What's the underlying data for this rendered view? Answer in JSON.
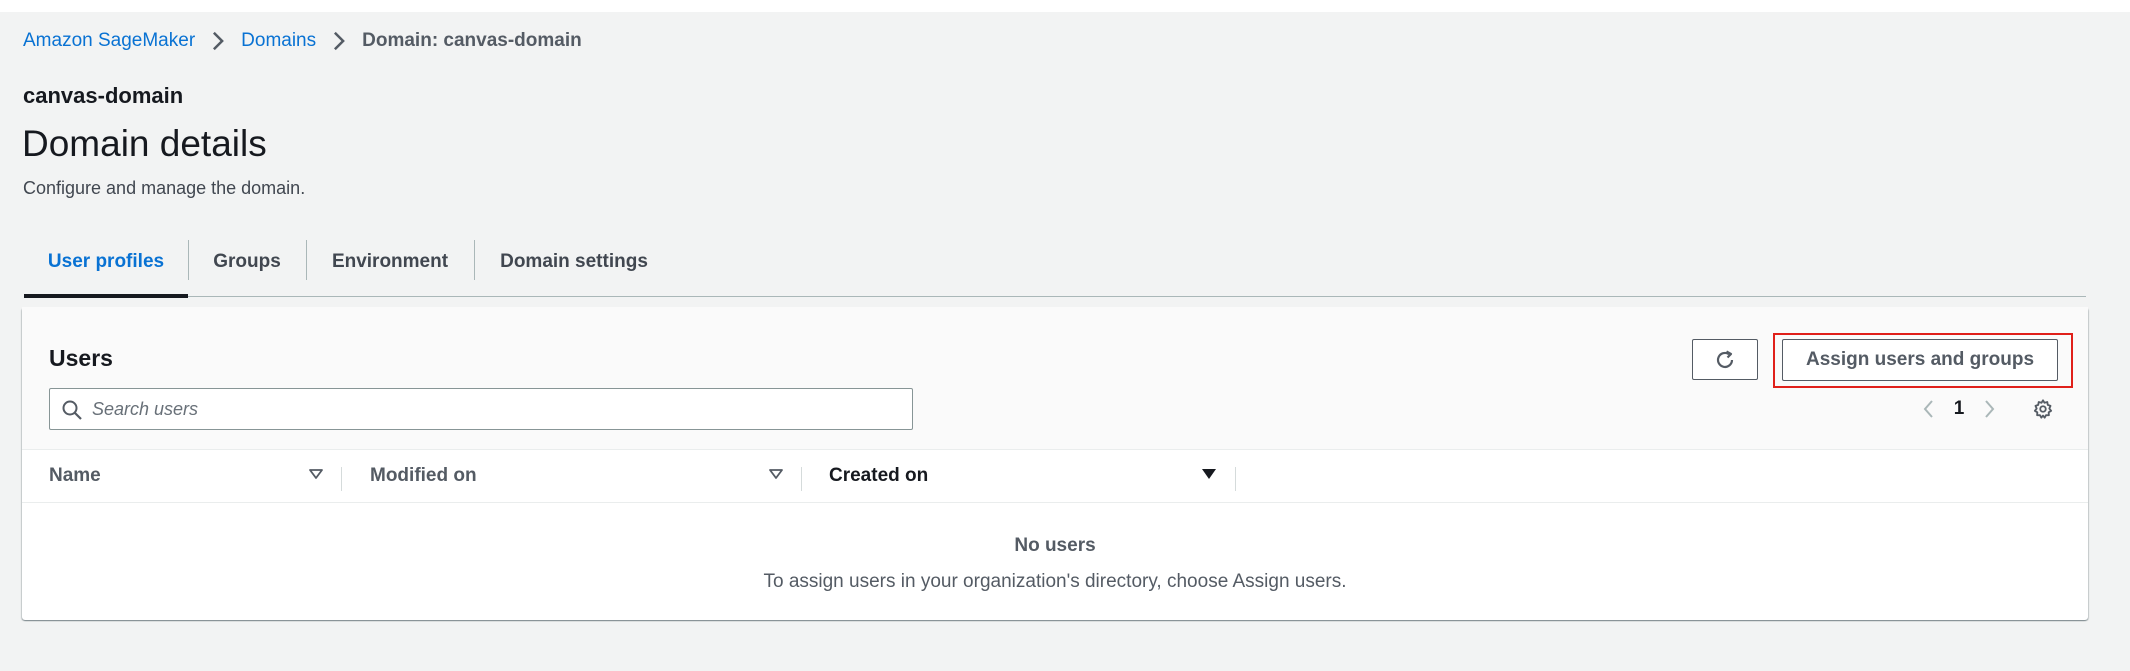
{
  "breadcrumb": {
    "items": [
      "Amazon SageMaker",
      "Domains"
    ],
    "current": "Domain: canvas-domain"
  },
  "header": {
    "domain_name": "canvas-domain",
    "title": "Domain details",
    "description": "Configure and manage the domain."
  },
  "tabs": [
    {
      "label": "User profiles",
      "active": true
    },
    {
      "label": "Groups",
      "active": false
    },
    {
      "label": "Environment",
      "active": false
    },
    {
      "label": "Domain settings",
      "active": false
    }
  ],
  "users_panel": {
    "title": "Users",
    "assign_button_label": "Assign users and groups",
    "refresh_icon": "refresh-icon",
    "search": {
      "placeholder": "Search users",
      "value": ""
    },
    "pagination": {
      "current_page": "1"
    },
    "columns": [
      {
        "label": "Name",
        "sort": "unsorted"
      },
      {
        "label": "Modified on",
        "sort": "unsorted"
      },
      {
        "label": "Created on",
        "sort": "descending"
      }
    ],
    "empty_state": {
      "title": "No users",
      "description": "To assign users in your organization's directory, choose Assign users."
    }
  },
  "colors": {
    "link": "#0972d3",
    "highlight": "#e0201a",
    "text": "#16191f",
    "muted": "#545b64",
    "background": "#f2f3f3"
  }
}
